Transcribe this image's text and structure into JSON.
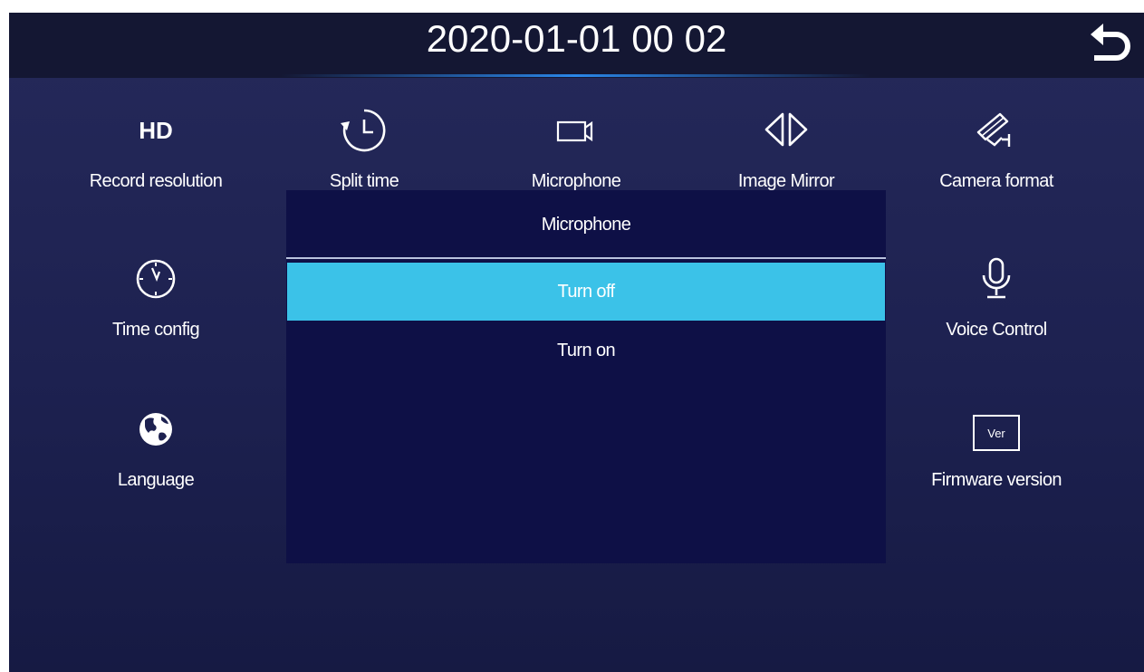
{
  "header": {
    "datetime": "2020-01-01  00 02",
    "back_icon": "undo-arrow-icon"
  },
  "tiles": [
    {
      "label": "Record resolution",
      "icon": "hd-icon",
      "icon_text": "HD"
    },
    {
      "label": "Split time",
      "icon": "clock-arrows-icon"
    },
    {
      "label": "Microphone",
      "icon": "video-camera-icon"
    },
    {
      "label": "Image Mirror",
      "icon": "mirror-arrows-icon"
    },
    {
      "label": "Camera format",
      "icon": "security-camera-icon"
    },
    {
      "label": "Time config",
      "icon": "clock-icon"
    },
    {
      "label": "Voice Control",
      "icon": "microphone-icon"
    },
    {
      "label": "Language",
      "icon": "globe-icon"
    },
    {
      "label": "Firmware version",
      "icon": "version-icon",
      "icon_text": "Ver"
    }
  ],
  "popup": {
    "title": "Microphone",
    "options": [
      {
        "label": "Turn off",
        "selected": true
      },
      {
        "label": "Turn on",
        "selected": false
      }
    ]
  },
  "colors": {
    "background": "#1f2352",
    "header": "#141733",
    "popup": "#0e1046",
    "selected": "#3bc2e8"
  }
}
